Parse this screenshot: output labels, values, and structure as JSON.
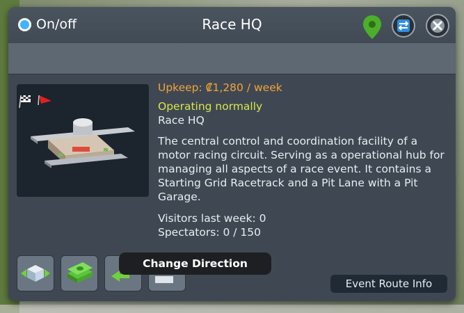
{
  "panel": {
    "toggle_label": "On/off",
    "title": "Race HQ"
  },
  "info": {
    "upkeep": "Upkeep: ₡1,280 / week",
    "status": "Operating normally",
    "building_name": "Race HQ",
    "description": "The central control and coordination facility of a motor racing circuit. Serving as a operational hub for managing all aspects of a race event. It contains a Starting Grid Racetrack and a Pit Lane with a Pit Garage.",
    "visitors": "Visitors last week: 0",
    "spectators": "Spectators: 0 / 150"
  },
  "tooltip": "Change Direction",
  "event_route_button": "Event Route Info",
  "colors": {
    "upkeep": "#f2a33a",
    "status": "#d9e64a",
    "panel_bg": "#3f4852",
    "toggle_on": "#3fb4ff",
    "pin": "#4caf2a"
  },
  "icons": {
    "location": "location-pin-icon",
    "routes": "routes-icon",
    "close": "close-icon",
    "move": "move-building-icon",
    "money": "money-icon",
    "direction": "change-direction-icon",
    "upgrade": "upgrade-icon"
  }
}
